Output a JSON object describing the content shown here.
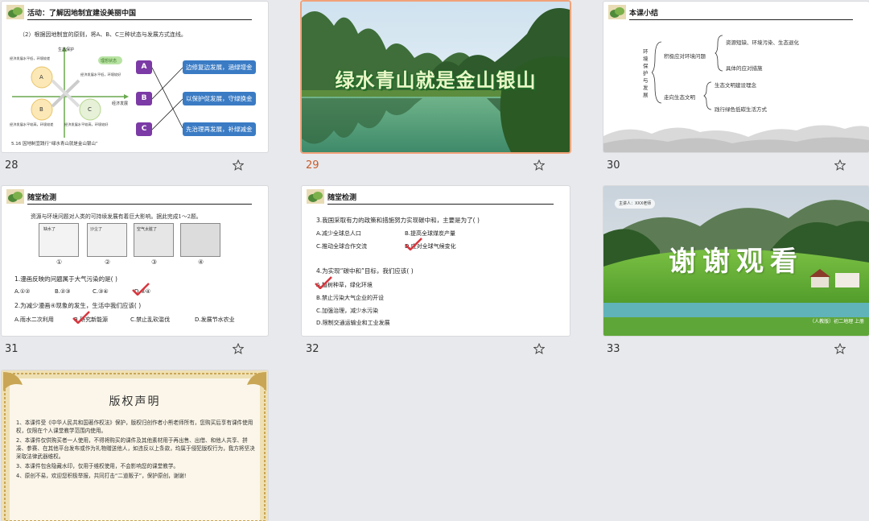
{
  "slides": [
    {
      "num": "28",
      "title": "活动：了解因地制宜建设美丽中国",
      "instruction": "（2）根据因地制宜的原则，将A、B、C三种状态与发展方式连线。",
      "axis_y": "生态保护",
      "axis_x": "经济发展",
      "ideal_label": "理想状态",
      "quad_a": "A",
      "quad_b": "B",
      "quad_c": "C",
      "small_labels": [
        "经济发展水平低，环境较差",
        "经济发展水平低，环境较好",
        "经济发展水平较高，环境较差",
        "经济发展水平较高，环境较好"
      ],
      "caption": "5.16 因地制宜践行“绿水青山就是金山银山”",
      "left_boxes": [
        "A",
        "B",
        "C"
      ],
      "right_boxes": [
        "边修复边发展，涵绿增金",
        "以保护促发展，守绿换金",
        "先治理再发展，补绿减金"
      ]
    },
    {
      "num": "29",
      "slogan": "绿水青山就是金山银山"
    },
    {
      "num": "30",
      "title": "本课小结",
      "root": "环境保护与发展",
      "branch1": "积极应对环境问题",
      "branch2": "走向生态文明",
      "leaf1": "资源短缺、环境污染、生态退化",
      "leaf2": "具体的应对措施",
      "leaf3": "生态文明建设理念",
      "leaf4": "践行绿色低碳生活方式"
    },
    {
      "num": "31",
      "title": "随堂检测",
      "intro": "资源与环境问题对人类的可持续发展有着巨大影响。据此完成1～2题。",
      "pic_labels": [
        "缺水了",
        "沙尘了",
        "空气太脏了",
        ""
      ],
      "pic_nums": [
        "①",
        "②",
        "③",
        "④"
      ],
      "q1": "1.漫画反映的问题属于大气污染的是(      )",
      "q1_opts": [
        "A.①②",
        "B.②③",
        "C.③④",
        "D.②④"
      ],
      "q2": "2.为减少漫画④现象的发生，生活中我们应该(      )",
      "q2_opts": [
        "A.雨水二次利用",
        "B.研究新能源",
        "C.禁止乱砍滥伐",
        "D.发展节水农业"
      ]
    },
    {
      "num": "32",
      "title": "随堂检测",
      "q3": "3.我国采取有力的政策和措施努力实现碳中和，主要是为了(      )",
      "q3_opts": [
        "A.减少全球总人口",
        "B.提高全球煤炭产量",
        "C.推动全球合作交流",
        "D.应对全球气候变化"
      ],
      "q4": "4.为实现“碳中和”目标，我们应该(      )",
      "q4_opts": [
        "A.植树种草，绿化环境",
        "B.禁止污染大气企业的开设",
        "C.加强治理，减少水污染",
        "D.限制交通运输业和工业发展"
      ]
    },
    {
      "num": "33",
      "thanks": "谢谢观看",
      "top_tag": "主讲人：XXX老师",
      "bottom_tag": "（人教版）初二地理 上册"
    },
    {
      "num": "",
      "title": "版权声明",
      "lines": [
        "1、本课件受《中华人民共和国著作权法》保护，版权归创作者小熊老师所有，您购买后享有课件使用权，仅限在个人课堂教学范围内使用。",
        "2、本课件仅供购买者一人使用，不得将购买的课件及其他素材用于再出售、出借、和他人共享、拼凑、参赛、在其他平台发布或作为礼物赠送他人，如违反以上条款，均属于侵犯版权行为，我方将坚决采取法律武器维权。",
        "3、本课件包含隐藏水印，仅用于维权使用，不会影响您的课堂教学。",
        "4、原创不易，欢迎您积极举报，共同打击“二道贩子”，保护原创，谢谢!"
      ]
    }
  ],
  "colors": {
    "background": "#e8e9ec",
    "selected_border": "#f0a27a",
    "selected_num": "#c95b2a",
    "purple_box": "#7b3aa6",
    "blue_box": "#3a7bc4",
    "check_red": "#d9363e"
  },
  "icons": [
    "star-icon",
    "leaf-icon"
  ]
}
